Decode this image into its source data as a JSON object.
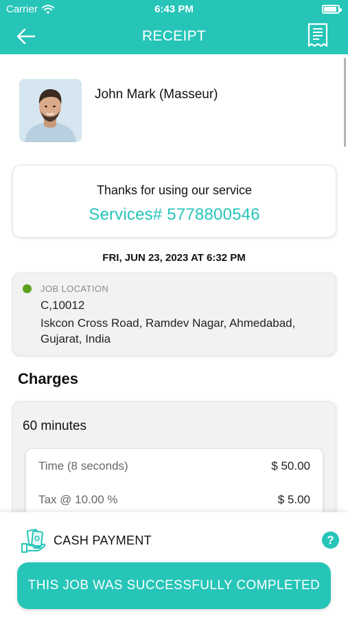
{
  "status_bar": {
    "carrier": "Carrier",
    "time": "6:43 PM"
  },
  "header": {
    "title": "RECEIPT"
  },
  "provider": {
    "name": "John Mark (Masseur)"
  },
  "summary": {
    "thanks_text": "Thanks for using our service",
    "service_number": "Services# 5778800546"
  },
  "date_time": "FRI, JUN 23, 2023 AT 6:32 PM",
  "location": {
    "label": "JOB LOCATION",
    "line1": "C,10012",
    "line2": "Iskcon Cross Road, Ramdev Nagar, Ahmedabad, Gujarat, India"
  },
  "charges": {
    "title": "Charges",
    "duration": "60 minutes",
    "items": [
      {
        "label": "Time (8 seconds)",
        "amount": "$ 50.00"
      },
      {
        "label": "Tax @ 10.00 %",
        "amount": "$ 5.00"
      }
    ]
  },
  "payment": {
    "method": "CASH PAYMENT",
    "help_symbol": "?"
  },
  "completion": {
    "button_label": "THIS JOB WAS SUCCESSFULLY COMPLETED"
  },
  "colors": {
    "accent": "#26c5b8",
    "location_dot": "#5fa01f",
    "card_bg": "#f2f2f2"
  }
}
